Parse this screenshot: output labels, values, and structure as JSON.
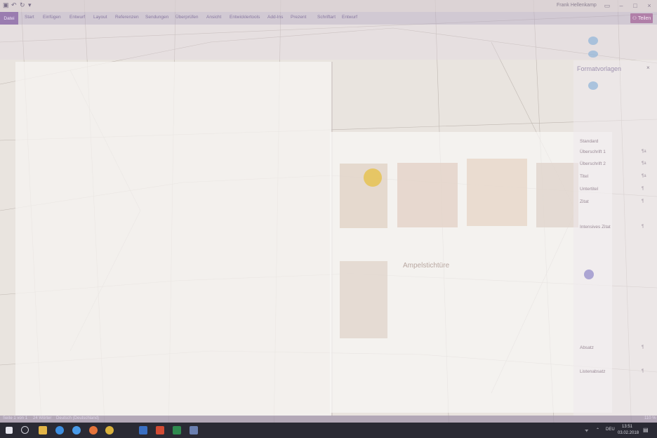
{
  "titlebar": {
    "document_title": "",
    "user_name": "Frank Hellenkamp"
  },
  "ribbon": {
    "tabs": [
      "Datei",
      "Start",
      "Einfügen",
      "Entwurf",
      "Layout",
      "Referenzen",
      "Sendungen",
      "Überprüfen",
      "Ansicht",
      "Entwicklertools",
      "Add-Ins",
      "Prezent",
      "Schriftart",
      "Entwurf"
    ],
    "share_label": "Teilen"
  },
  "pane": {
    "title": "Formatvorlagen",
    "close": "×",
    "items": [
      {
        "label": "Standard",
        "num": ""
      },
      {
        "label": "Überschrift 1",
        "num": "¶a"
      },
      {
        "label": "Überschrift 2",
        "num": "¶a"
      },
      {
        "label": "Titel",
        "num": "¶a"
      },
      {
        "label": "Untertitel",
        "num": "¶"
      },
      {
        "label": "Zitat",
        "num": "¶"
      },
      {
        "label": "Intensives Zitat",
        "num": "¶"
      },
      {
        "label": "Absatz",
        "num": "¶"
      },
      {
        "label": "Listenabsatz",
        "num": "¶"
      }
    ]
  },
  "dialog": {
    "caption": "Ampelstichtüre"
  },
  "status": {
    "page": "Seite 1 von 1",
    "words": "24 Wörter",
    "language": "Deutsch (Deutschland)",
    "zoom": "110 %"
  },
  "taskbar": {
    "lang": "DEU",
    "time": "13:51",
    "date": "03.02.2018"
  },
  "colors": {
    "accent": "#9a7cb0",
    "taskbar": "#2a2a34"
  }
}
